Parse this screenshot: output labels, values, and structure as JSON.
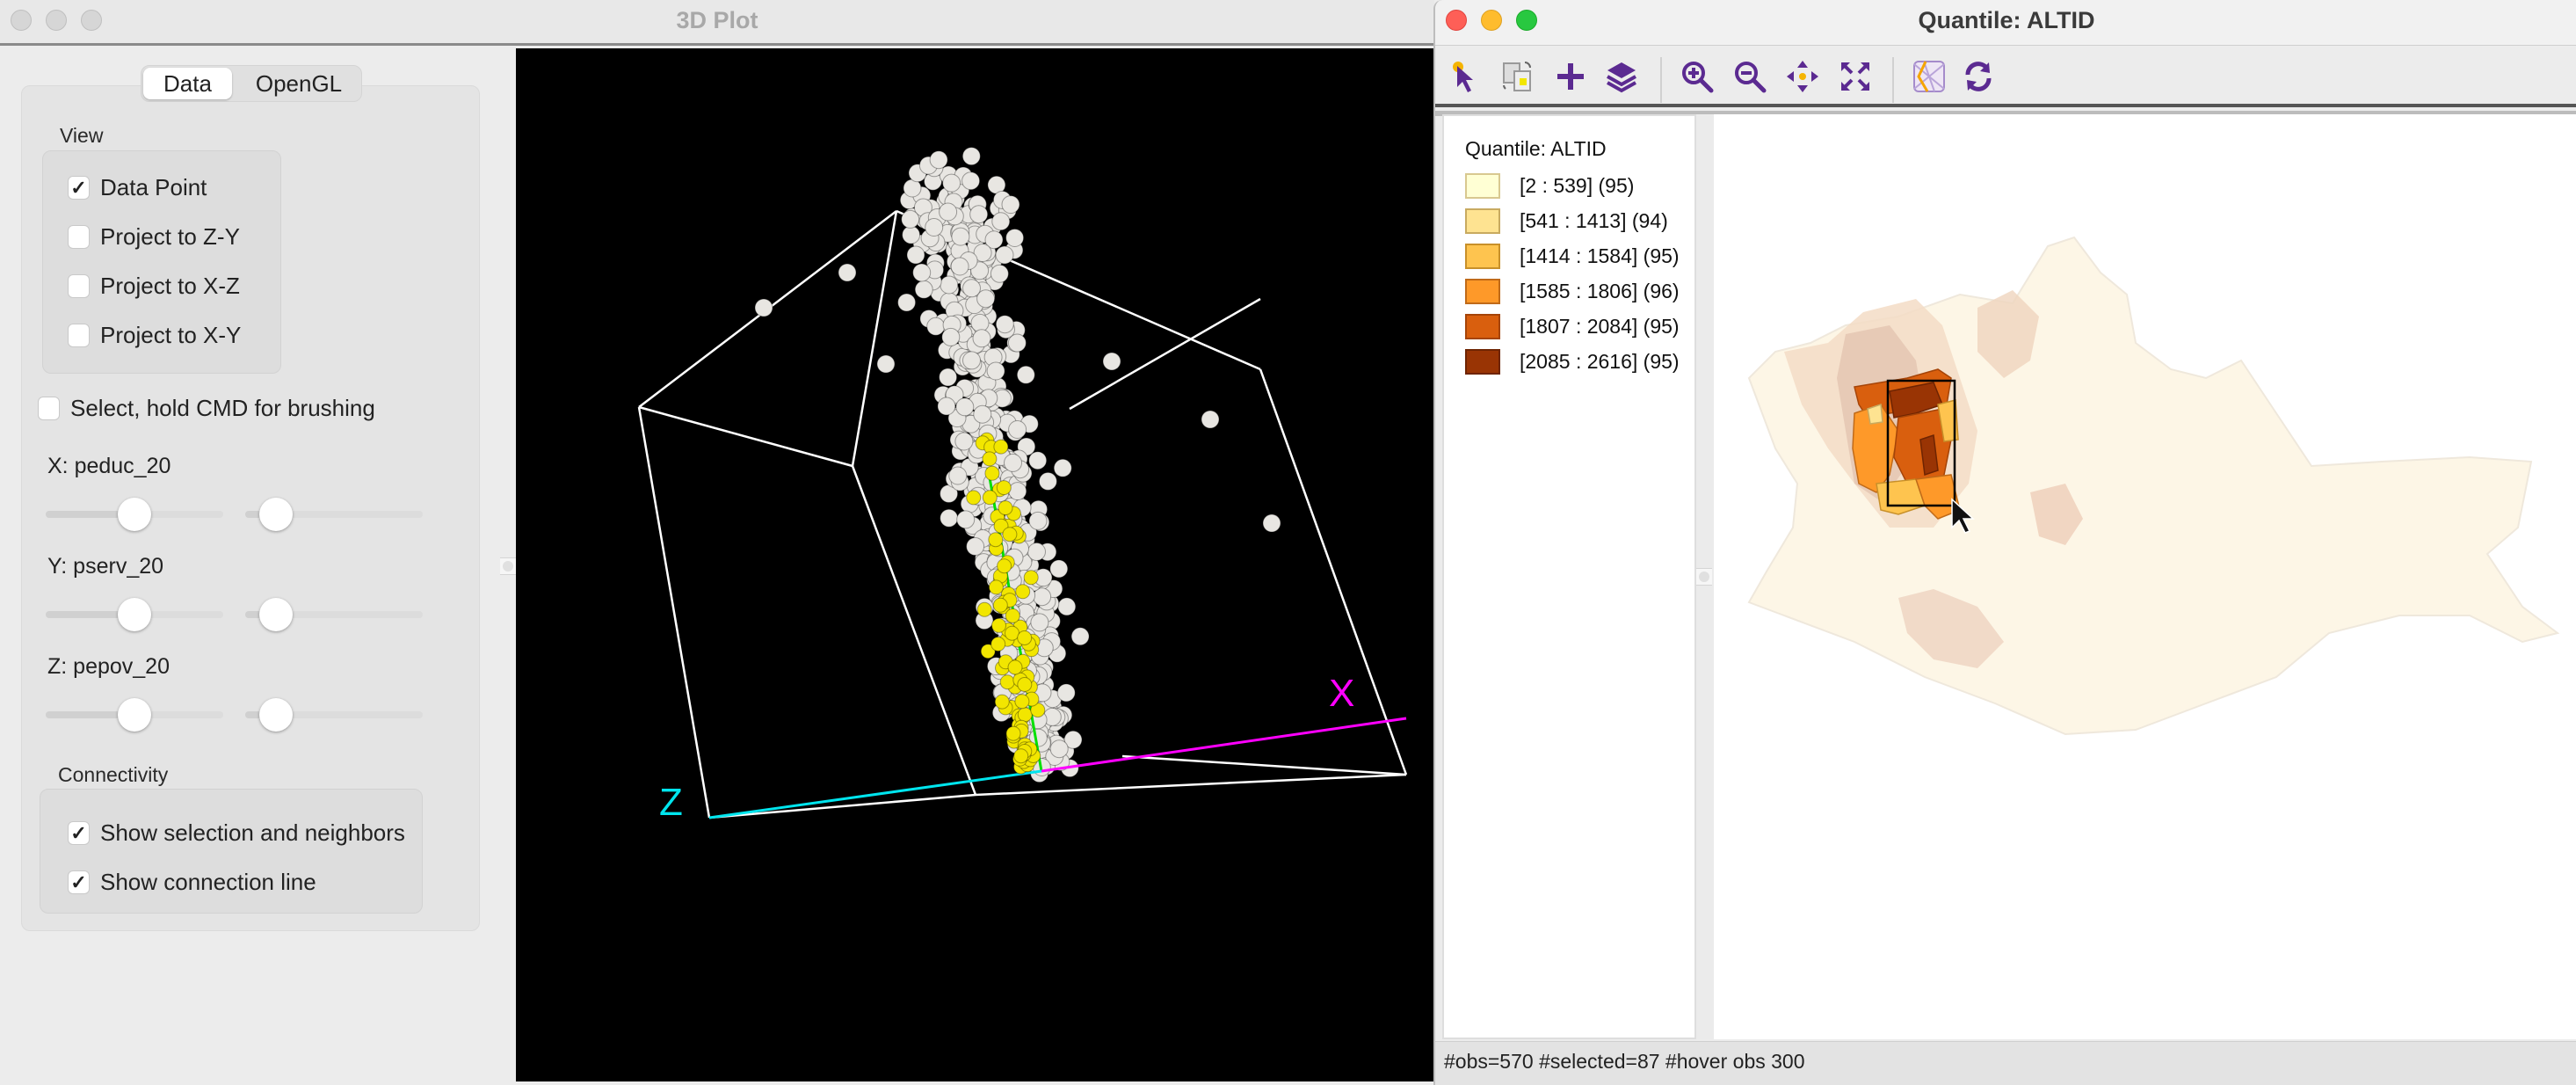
{
  "left_window": {
    "title": "3D Plot",
    "tabs": [
      {
        "label": "Data",
        "active": true
      },
      {
        "label": "OpenGL",
        "active": false
      }
    ],
    "view": {
      "label": "View",
      "options": [
        {
          "label": "Data Point",
          "checked": true
        },
        {
          "label": "Project to Z-Y",
          "checked": false
        },
        {
          "label": "Project to X-Z",
          "checked": false
        },
        {
          "label": "Project to X-Y",
          "checked": false
        }
      ]
    },
    "select_brush": {
      "label": "Select, hold CMD for brushing",
      "checked": false
    },
    "axes": [
      {
        "label": "X: peduc_20",
        "slider_a": 0.5,
        "slider_b": 0.1
      },
      {
        "label": "Y: pserv_20",
        "slider_a": 0.5,
        "slider_b": 0.1
      },
      {
        "label": "Z: pepov_20",
        "slider_a": 0.5,
        "slider_b": 0.1
      }
    ],
    "connectivity": {
      "label": "Connectivity",
      "options": [
        {
          "label": "Show selection and neighbors",
          "checked": true
        },
        {
          "label": "Show connection line",
          "checked": true
        }
      ]
    },
    "plot": {
      "axis_labels": {
        "x": "X",
        "z": "Z"
      },
      "colors": {
        "background": "#000000",
        "box": "#ffffff",
        "x_axis": "#ff00ff",
        "y_axis": "#00e000",
        "z_axis": "#00e5ee",
        "point": "#e8e6e2",
        "selected_point": "#f2e600"
      }
    }
  },
  "right_window": {
    "title": "Quantile: ALTID",
    "toolbar": [
      {
        "name": "select-tool",
        "icon": "arrow-cursor-icon"
      },
      {
        "name": "copy-image",
        "icon": "copy-image-icon"
      },
      {
        "name": "add-layer",
        "icon": "plus-icon"
      },
      {
        "name": "layers",
        "icon": "layers-icon"
      },
      {
        "name": "zoom-in",
        "icon": "zoom-in-icon"
      },
      {
        "name": "zoom-out",
        "icon": "zoom-out-icon"
      },
      {
        "name": "pan",
        "icon": "pan-icon"
      },
      {
        "name": "fit-extent",
        "icon": "fit-extent-icon"
      },
      {
        "name": "basemap",
        "icon": "basemap-icon"
      },
      {
        "name": "refresh",
        "icon": "refresh-icon"
      }
    ],
    "legend": {
      "title": "Quantile: ALTID",
      "items": [
        {
          "label": "[2 : 539] (95)",
          "color": "#ffffd4",
          "border": "#d8c890"
        },
        {
          "label": "[541 : 1413] (94)",
          "color": "#fee391",
          "border": "#c8aa60"
        },
        {
          "label": "[1414 : 1584] (95)",
          "color": "#fec44f",
          "border": "#c8902a"
        },
        {
          "label": "[1585 : 1806] (96)",
          "color": "#fe9929",
          "border": "#c06a18"
        },
        {
          "label": "[1807 : 2084] (95)",
          "color": "#d95f0e",
          "border": "#a54408"
        },
        {
          "label": "[2085 : 2616] (95)",
          "color": "#993404",
          "border": "#6e2402"
        }
      ]
    },
    "status": "#obs=570 #selected=87  #hover obs 300"
  }
}
